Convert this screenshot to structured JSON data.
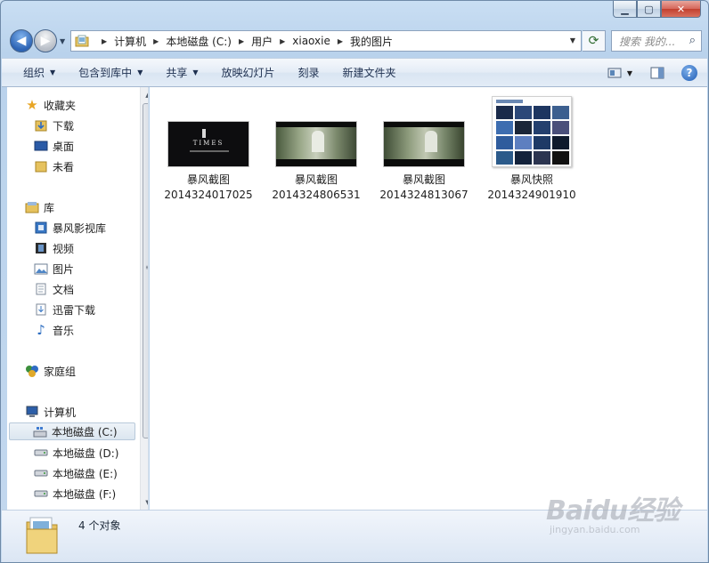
{
  "window": {
    "caption_buttons": [
      "minimize",
      "maximize",
      "close"
    ]
  },
  "address": {
    "crumbs": [
      "计算机",
      "本地磁盘 (C:)",
      "用户",
      "xiaoxie",
      "我的图片"
    ]
  },
  "search": {
    "placeholder": "搜索 我的..."
  },
  "toolbar": {
    "organize": "组织",
    "include_in_library": "包含到库中",
    "share": "共享",
    "slideshow": "放映幻灯片",
    "burn": "刻录",
    "new_folder": "新建文件夹"
  },
  "navpane": {
    "favorites": "收藏夹",
    "downloads": "下载",
    "desktop": "桌面",
    "recent": "未看",
    "libraries": "库",
    "baofeng_lib": "暴风影视库",
    "videos": "视频",
    "pictures": "图片",
    "documents": "文档",
    "xunlei": "迅雷下载",
    "music": "音乐",
    "homegroup": "家庭组",
    "computer": "计算机",
    "drive_c": "本地磁盘 (C:)",
    "drive_d": "本地磁盘 (D:)",
    "drive_e": "本地磁盘 (E:)",
    "drive_f": "本地磁盘 (F:)"
  },
  "files": [
    {
      "name_line1": "暴风截图",
      "name_line2": "2014324017025",
      "thumb_text": "TIMES"
    },
    {
      "name_line1": "暴风截图",
      "name_line2": "2014324806531"
    },
    {
      "name_line1": "暴风截图",
      "name_line2": "2014324813067"
    },
    {
      "name_line1": "暴风快照",
      "name_line2": "2014324901910"
    }
  ],
  "status": {
    "count": "4 个对象"
  },
  "watermark": {
    "main": "Baidu经验",
    "sub": "jingyan.baidu.com"
  }
}
